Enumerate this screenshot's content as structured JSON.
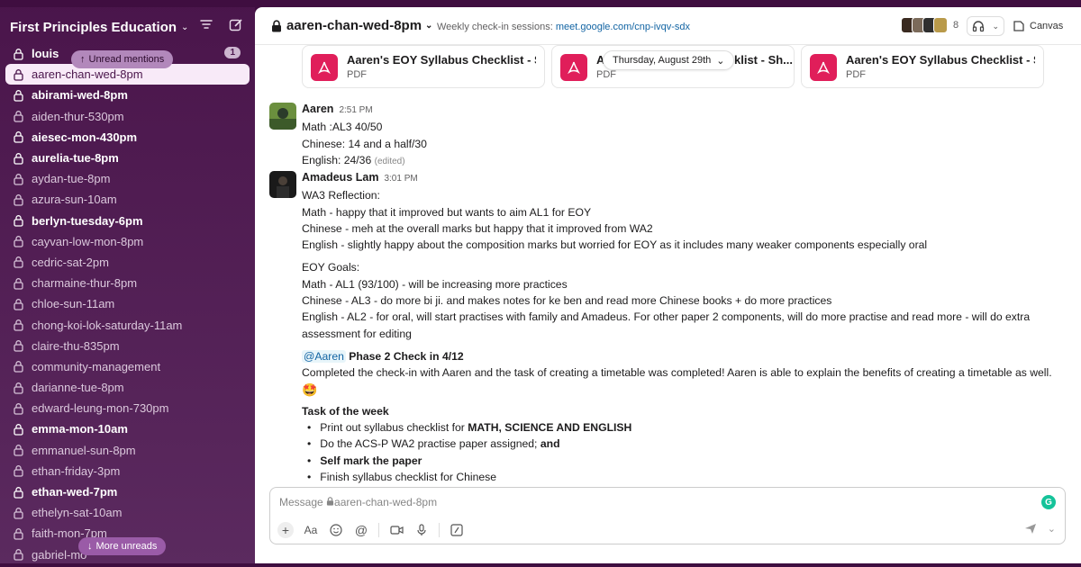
{
  "workspace": {
    "name": "First Principles Education"
  },
  "sidebar": {
    "channels": [
      {
        "label": "louis",
        "bold": true
      },
      {
        "label": "aaren-chan-wed-8pm",
        "active": true
      },
      {
        "label": "abirami-wed-8pm",
        "bold": true
      },
      {
        "label": "aiden-thur-530pm"
      },
      {
        "label": "aiesec-mon-430pm",
        "bold": true
      },
      {
        "label": "aurelia-tue-8pm",
        "bold": true
      },
      {
        "label": "aydan-tue-8pm"
      },
      {
        "label": "azura-sun-10am"
      },
      {
        "label": "berlyn-tuesday-6pm",
        "bold": true
      },
      {
        "label": "cayvan-low-mon-8pm"
      },
      {
        "label": "cedric-sat-2pm"
      },
      {
        "label": "charmaine-thur-8pm"
      },
      {
        "label": "chloe-sun-11am"
      },
      {
        "label": "chong-koi-lok-saturday-11am"
      },
      {
        "label": "claire-thu-835pm"
      },
      {
        "label": "community-management"
      },
      {
        "label": "darianne-tue-8pm"
      },
      {
        "label": "edward-leung-mon-730pm"
      },
      {
        "label": "emma-mon-10am",
        "bold": true
      },
      {
        "label": "emmanuel-sun-8pm"
      },
      {
        "label": "ethan-friday-3pm"
      },
      {
        "label": "ethan-wed-7pm",
        "bold": true
      },
      {
        "label": "ethelyn-sat-10am"
      },
      {
        "label": "faith-mon-7pm"
      },
      {
        "label": "gabriel-mo"
      }
    ],
    "louis_badge": "1",
    "unread_mentions": "Unread mentions",
    "more_unreads": "More unreads"
  },
  "header": {
    "channel": "aaren-chan-wed-8pm",
    "desc_prefix": "Weekly check-in sessions:",
    "desc_link": "meet.google.com/cnp-ivqv-sdx",
    "member_count": "8",
    "canvas": "Canvas"
  },
  "attachments": [
    {
      "title": "Aaren's EOY Syllabus Checklist - Sh...",
      "type": "PDF"
    },
    {
      "title": "A",
      "title_tail": "klist - Sh...",
      "type": "PDF"
    },
    {
      "title": "Aaren's EOY Syllabus Checklist - Sh...",
      "type": "PDF"
    }
  ],
  "date_divider": "Thursday, August 29th",
  "messages": {
    "m1": {
      "author": "Aaren",
      "time": "2:51 PM",
      "lines": [
        "Math :AL3 40/50",
        "Chinese: 14 and a half/30",
        "English: 24/36"
      ],
      "edited": "(edited)"
    },
    "m2": {
      "author": "Amadeus Lam",
      "time": "3:01 PM",
      "reflection": [
        "WA3 Reflection:",
        "Math - happy that it improved but wants to aim AL1 for EOY",
        "Chinese - meh at the overall marks but happy that it improved from WA2",
        "English - slightly happy about the composition marks but worried for EOY as it includes many weaker components especially oral"
      ],
      "goals": [
        "EOY Goals:",
        "Math - AL1 (93/100) - will be increasing more practices",
        "Chinese - AL3 - do more bi ji. and makes notes for ke ben and read more Chinese books + do more practices",
        "English - AL2 - for oral, will start practises with family and Amadeus. For other paper 2 components, will do more practise and read more - will do extra assessment for editing"
      ],
      "mention": "@Aaren",
      "phase": "Phase 2 Check in 4/12",
      "completed": "Completed the check-in with Aaren and the task of creating a timetable was completed! Aaren is able to explain the benefits of creating a timetable as well.",
      "emoji": "🤩",
      "task_heading": "Task of the week",
      "task1_prefix": "Print out syllabus checklist for ",
      "task1_bold": "MATH, SCIENCE AND ENGLISH",
      "task2_prefix": "Do the ACS-P WA2 practise paper assigned; ",
      "task2_bold": "and",
      "task3": "Self mark the paper",
      "task4": "Finish syllabus checklist for Chinese"
    }
  },
  "composer": {
    "message_word": "Message",
    "channel": "aaren-chan-wed-8pm"
  },
  "colors": {
    "sidebar": "#4a154b",
    "pdf": "#e01e5a",
    "link": "#1264a3",
    "grammarly": "#15c39a"
  }
}
